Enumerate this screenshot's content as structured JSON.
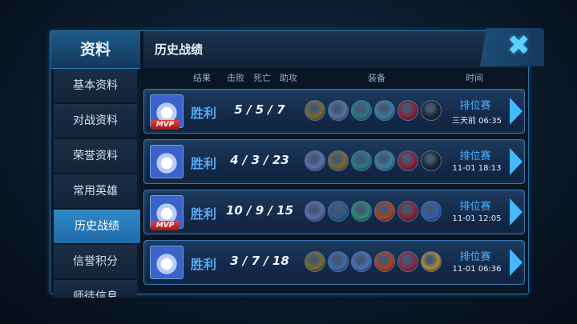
{
  "sidebar": {
    "header": "资料",
    "items": [
      {
        "label": "基本资料"
      },
      {
        "label": "对战资料"
      },
      {
        "label": "荣誉资料"
      },
      {
        "label": "常用英雄"
      },
      {
        "label": "历史战绩"
      },
      {
        "label": "信誉积分"
      },
      {
        "label": "师徒信息"
      }
    ],
    "active_index": 4
  },
  "panel": {
    "title": "历史战绩",
    "close_icon": "close-icon"
  },
  "columns": {
    "result": "结果",
    "kills": "击败",
    "deaths": "死亡",
    "assists": "助攻",
    "equipment": "装备",
    "time": "时间"
  },
  "matches": [
    {
      "result": "胜利",
      "kda": "5 / 5 / 7",
      "mvp": "MVP",
      "mode": "排位赛",
      "time": "三天前 06:35",
      "item_colors": [
        "#7a6b2a",
        "#5b6fa8",
        "#2a7a8a",
        "#3a7ea0",
        "#8a2030",
        "#1a2330"
      ]
    },
    {
      "result": "胜利",
      "kda": "4 / 3 / 23",
      "mvp": "",
      "mode": "排位赛",
      "time": "11-01  18:13",
      "item_colors": [
        "#5b6fa8",
        "#7a6b2a",
        "#2a7a8a",
        "#3a7ea0",
        "#8a2030",
        "#1a2330"
      ]
    },
    {
      "result": "胜利",
      "kda": "10 / 9 / 15",
      "mvp": "MVP",
      "mode": "排位赛",
      "time": "11-01  12:05",
      "item_colors": [
        "#5b6fa8",
        "#2a5a8a",
        "#2a8a7a",
        "#b0401a",
        "#8a2030",
        "#3060b0"
      ]
    },
    {
      "result": "胜利",
      "kda": "3 / 7 / 18",
      "mvp": "",
      "mode": "排位赛",
      "time": "11-01  06:36",
      "item_colors": [
        "#7a6b2a",
        "#3a6ab0",
        "#4a70b8",
        "#b0401a",
        "#8a2840",
        "#b08a30"
      ]
    }
  ]
}
